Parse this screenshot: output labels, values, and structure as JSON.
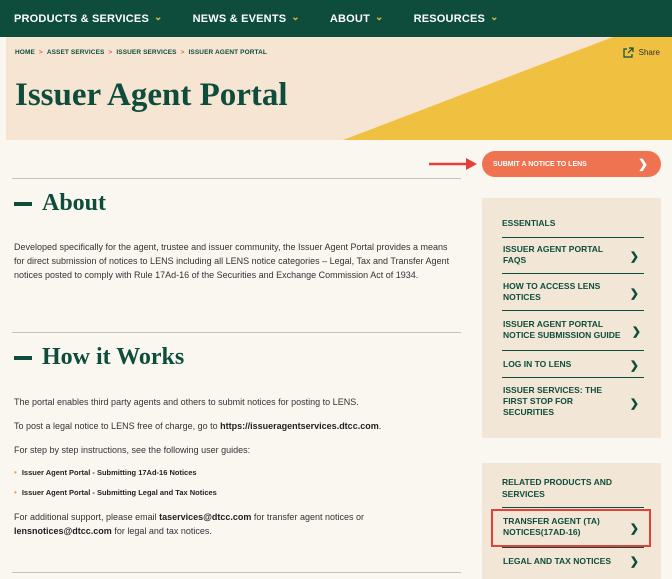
{
  "nav": {
    "items": [
      {
        "label": "PRODUCTS & SERVICES"
      },
      {
        "label": "NEWS & EVENTS"
      },
      {
        "label": "ABOUT"
      },
      {
        "label": "RESOURCES"
      }
    ]
  },
  "breadcrumb": [
    "HOME",
    "ASSET SERVICES",
    "ISSUER SERVICES",
    "ISSUER AGENT PORTAL"
  ],
  "page": {
    "title": "Issuer Agent Portal",
    "share_label": "Share",
    "submit_label": "SUBMIT A NOTICE TO LENS"
  },
  "about": {
    "heading": "About",
    "body": "Developed specifically for the agent, trustee and issuer community, the Issuer Agent Portal provides a means for direct submission of notices to LENS including all LENS notice categories – Legal, Tax and Transfer Agent notices posted to comply with Rule 17Ad-16 of the Securities and Exchange Commission Act of 1934."
  },
  "how": {
    "heading": "How it Works",
    "p1": "The portal enables third party agents and others to submit notices for posting to LENS.",
    "p2_prefix": "To post a legal notice to LENS free of charge, go to ",
    "p2_link": "https://issueragentservices.dtcc.com",
    "p2_suffix": ".",
    "p3": "For step by step instructions, see the following user guides:",
    "guides": [
      "Issuer Agent Portal - Submitting 17Ad-16 Notices",
      "Issuer Agent Portal - Submitting Legal and Tax Notices"
    ],
    "p4_prefix": "For additional support, please email ",
    "p4_email1": "taservices@dtcc.com",
    "p4_mid": " for transfer agent notices or ",
    "p4_email2": "lensnotices@dtcc.com",
    "p4_suffix": " for legal and tax notices."
  },
  "essentials": {
    "heading": "ESSENTIALS",
    "items": [
      {
        "label": "ISSUER AGENT PORTAL FAQS"
      },
      {
        "label": "HOW TO ACCESS LENS NOTICES"
      },
      {
        "label": "ISSUER AGENT PORTAL NOTICE SUBMISSION GUIDE"
      },
      {
        "label": "LOG IN TO LENS"
      },
      {
        "label": "ISSUER SERVICES: THE FIRST STOP FOR SECURITIES"
      }
    ]
  },
  "related": {
    "heading": "RELATED PRODUCTS AND SERVICES",
    "items": [
      {
        "label": "TRANSFER AGENT (TA) NOTICES(17AD-16)"
      },
      {
        "label": "LEGAL AND TAX NOTICES"
      }
    ]
  },
  "colors": {
    "brand_green": "#0e4d3c",
    "accent_orange": "#ef7350",
    "accent_yellow": "#f0c040",
    "hero_bg": "#f6e5d3"
  }
}
